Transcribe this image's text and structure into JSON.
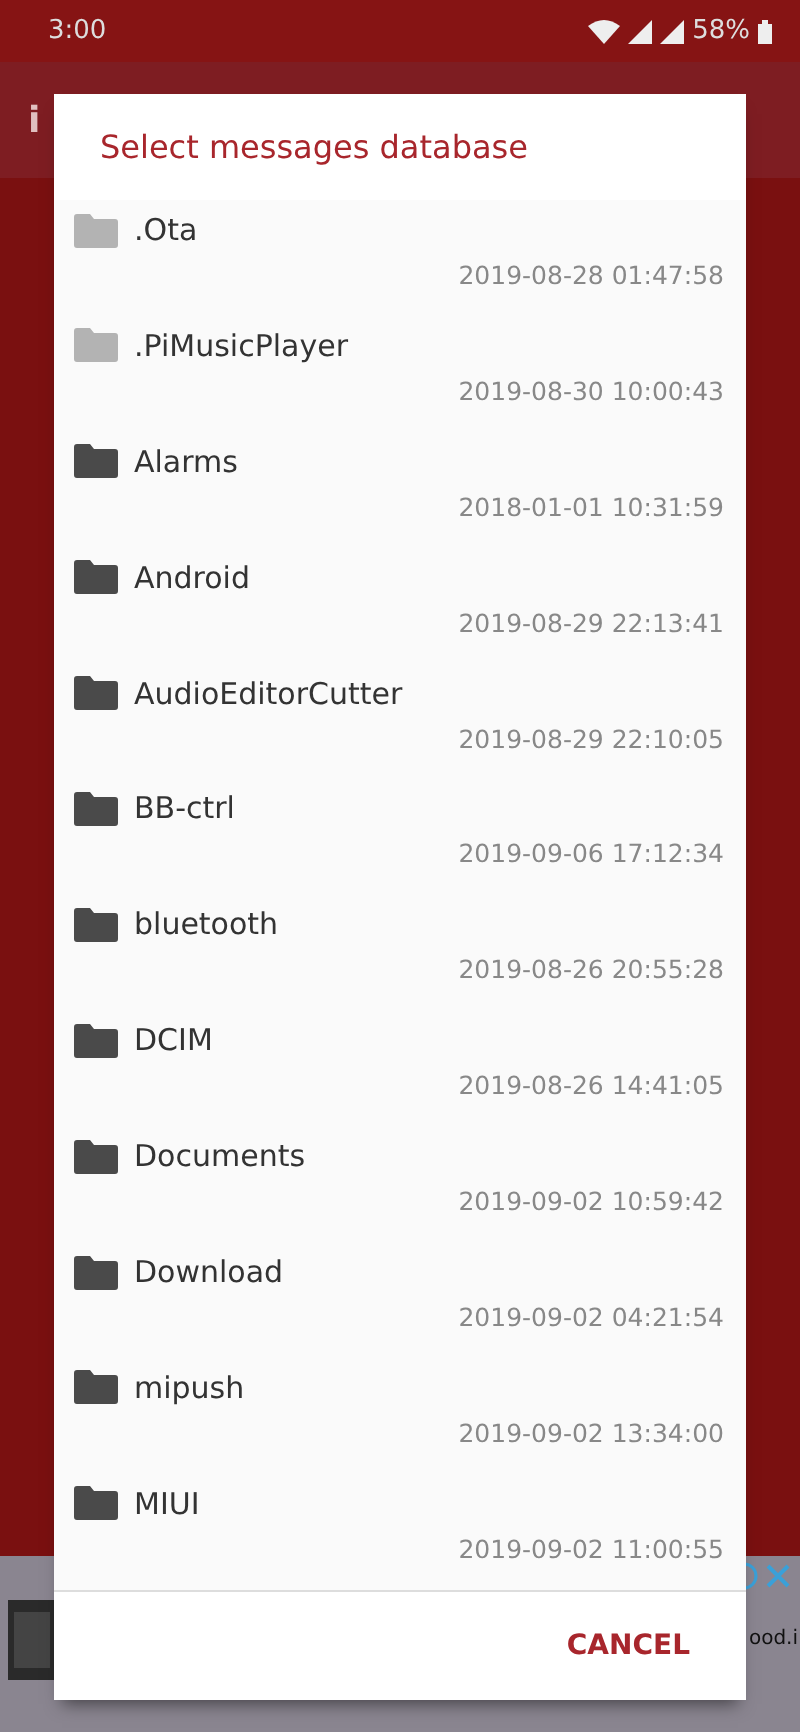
{
  "status_bar": {
    "time": "3:00",
    "battery": "58%"
  },
  "app_bar": {
    "title": "i"
  },
  "ad": {
    "text": "ood.i"
  },
  "dialog": {
    "title": "Select messages database",
    "items": [
      {
        "name": ".Ota",
        "date": "2019-08-28 01:47:58",
        "hidden": true
      },
      {
        "name": ".PiMusicPlayer",
        "date": "2019-08-30 10:00:43",
        "hidden": true
      },
      {
        "name": "Alarms",
        "date": "2018-01-01 10:31:59",
        "hidden": false
      },
      {
        "name": "Android",
        "date": "2019-08-29 22:13:41",
        "hidden": false
      },
      {
        "name": "AudioEditorCutter",
        "date": "2019-08-29 22:10:05",
        "hidden": false
      },
      {
        "name": "BB-ctrl",
        "date": "2019-09-06 17:12:34",
        "hidden": false
      },
      {
        "name": "bluetooth",
        "date": "2019-08-26 20:55:28",
        "hidden": false
      },
      {
        "name": "DCIM",
        "date": "2019-08-26 14:41:05",
        "hidden": false
      },
      {
        "name": "Documents",
        "date": "2019-09-02 10:59:42",
        "hidden": false
      },
      {
        "name": "Download",
        "date": "2019-09-02 04:21:54",
        "hidden": false
      },
      {
        "name": "mipush",
        "date": "2019-09-02 13:34:00",
        "hidden": false
      },
      {
        "name": "MIUI",
        "date": "2019-09-02 11:00:55",
        "hidden": false
      }
    ],
    "buttons": [
      "CANCEL"
    ]
  }
}
